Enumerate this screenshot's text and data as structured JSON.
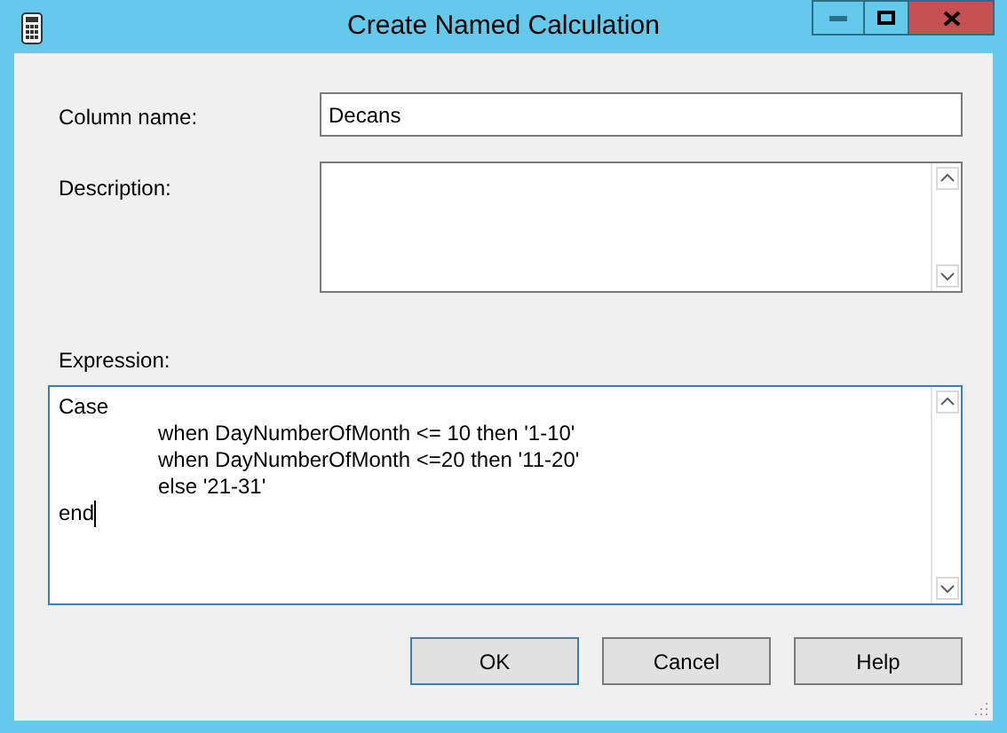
{
  "window": {
    "title": "Create Named Calculation"
  },
  "fields": [
    {
      "label": "Column name:",
      "value": "Decans"
    },
    {
      "label": "Description:"
    }
  ],
  "expression": {
    "label": "Expression:",
    "lines": [
      {
        "kind": "plain",
        "text": "Case"
      },
      {
        "kind": "indented",
        "text": "when DayNumberOfMonth <= 10 then '1-10'"
      },
      {
        "kind": "indented",
        "text": "when DayNumberOfMonth <=20 then '11-20'"
      },
      {
        "kind": "indented",
        "text": "else '21-31'"
      },
      {
        "kind": "plain",
        "text": "end"
      }
    ]
  },
  "buttons": [
    {
      "label": "OK",
      "default": true
    },
    {
      "label": "Cancel",
      "default": false
    },
    {
      "label": "Help",
      "default": false
    }
  ]
}
